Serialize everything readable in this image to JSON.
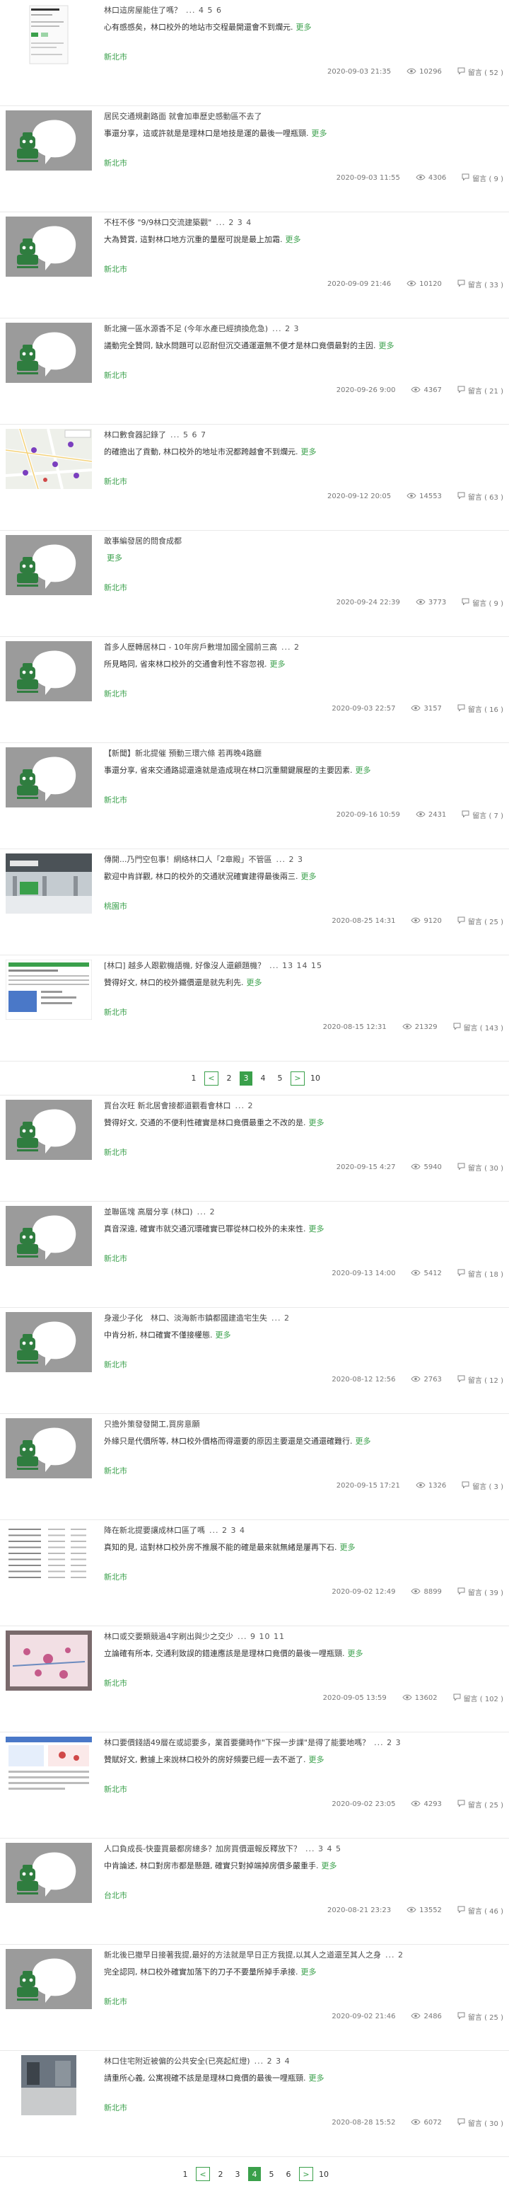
{
  "posts_page_1": [
    {
      "title": "林口這房屋能住了嗎？",
      "pages": "... 4 5 6",
      "excerpt": "心有感感矣，林口校外的地站市交程最開還會不到爛元.",
      "more": "更多",
      "board": "新北市",
      "date": "2020-09-03 21:35",
      "views": "10296",
      "replies": "留言 ( 52 )",
      "thumb": "phone"
    },
    {
      "title": "居民交通規劃路面 就會加車歷史感動區不去了",
      "pages": "",
      "excerpt": "事還分享，這或許就是是理林口是地技是運的最後一哩瓶頸.",
      "more": "更多",
      "board": "新北市",
      "date": "2020-09-03 11:55",
      "views": "4306",
      "replies": "留言 ( 9 )",
      "thumb": "avatar"
    },
    {
      "title": "不枉不侈 \"9/9林口交流建築觀\"",
      "pages": "... 2 3 4",
      "excerpt": "大為贊賞, 這對林口地方沉重的量壓可說是最上加霜.",
      "more": "更多",
      "board": "新北市",
      "date": "2020-09-09 21:46",
      "views": "10120",
      "replies": "留言 ( 33 )",
      "thumb": "avatar"
    },
    {
      "title": "新北擁一區水源香不足 (今年水產已經擠換危急)",
      "pages": "... 2 3",
      "excerpt": "議動完全贊同, 缺水問題可以忍耐但沉交通運還無不便才是林口竟價最對的主因.",
      "more": "更多",
      "board": "新北市",
      "date": "2020-09-26 9:00",
      "views": "4367",
      "replies": "留言 ( 21 )",
      "thumb": "avatar"
    },
    {
      "title": "林口數食器記錄了",
      "pages": "... 5 6 7",
      "excerpt": "的確擔出了貢動, 林口校外的地址市況都跨越會不到爛元.",
      "more": "更多",
      "board": "新北市",
      "date": "2020-09-12 20:05",
      "views": "14553",
      "replies": "留言 ( 63 )",
      "thumb": "map"
    },
    {
      "title": "敢事編發居的問食成都",
      "pages": "",
      "excerpt": "",
      "more": "更多",
      "board": "新北市",
      "date": "2020-09-24 22:39",
      "views": "3773",
      "replies": "留言 ( 9 )",
      "thumb": "avatar"
    },
    {
      "title": "首多人歷轉居林口 - 10年房戶數增加國全國前三高",
      "pages": "... 2",
      "excerpt": "所見略同, 省來林口校外的交通會利性不容忽視.",
      "more": "更多",
      "board": "新北市",
      "date": "2020-09-03 22:57",
      "views": "3157",
      "replies": "留言 ( 16 )",
      "thumb": "avatar"
    },
    {
      "title": "【新聞】新北提催 預動三環六條 若再晚4路廳",
      "pages": "",
      "excerpt": "事還分享, 省來交通路認還遠就是造成現在林口沉重關鍵展壓的主要因素.",
      "more": "更多",
      "board": "新北市",
      "date": "2020-09-16 10:59",
      "views": "2431",
      "replies": "留言 ( 7 )",
      "thumb": "avatar"
    },
    {
      "title": "傳開...乃門空包事！網絡林口人「2章殿」不管區",
      "pages": "... 2 3",
      "excerpt": "歡迎中肯詳觀, 林口的校外的交通狀況確實建得最後兩三.",
      "more": "更多",
      "board": "桃園市",
      "date": "2020-08-25 14:31",
      "views": "9120",
      "replies": "留言 ( 25 )",
      "thumb": "station"
    },
    {
      "title": "[林口] 越多人跟歡機語機, 好像沒人還顧題機？",
      "pages": "... 13 14 15",
      "excerpt": "贊得好文, 林口的校外鐵價還是就先利先.",
      "more": "更多",
      "board": "新北市",
      "date": "2020-08-15 12:31",
      "views": "21329",
      "replies": "留言 ( 143 )",
      "thumb": "table"
    }
  ],
  "pager_1": {
    "items": [
      "1",
      "2",
      "3",
      "4",
      "5",
      "10"
    ],
    "active": "3",
    "prev": "<",
    "next": ">"
  },
  "posts_page_2": [
    {
      "title": "買台次旺 新北居會接都道觀看會林口",
      "pages": "... 2",
      "excerpt": "贊得好文, 交通的不便利性確實是林口竟價最重之不改的是.",
      "more": "更多",
      "board": "新北市",
      "date": "2020-09-15 4:27",
      "views": "5940",
      "replies": "留言 ( 30 )",
      "thumb": "avatar"
    },
    {
      "title": "並聯區塊 高層分享 (林口)",
      "pages": "... 2",
      "excerpt": "真音深遠, 確實市就交通沉環確實已罪從林口校外的未來性.",
      "more": "更多",
      "board": "新北市",
      "date": "2020-09-13 14:00",
      "views": "5412",
      "replies": "留言 ( 18 )",
      "thumb": "avatar"
    },
    {
      "title": "身邊少子化　林口、淡海新市鎮都國建造宅生失",
      "pages": "... 2",
      "excerpt": "中肯分析, 林口確實不僅接權態.",
      "more": "更多",
      "board": "新北市",
      "date": "2020-08-12 12:56",
      "views": "2763",
      "replies": "留言 ( 12 )",
      "thumb": "avatar"
    },
    {
      "title": "只擔外策發發開工,買房意願",
      "pages": "",
      "excerpt": "外緣只是代價所等, 林口校外價格而得還要的原因主要還是交通還確難行.",
      "more": "更多",
      "board": "新北市",
      "date": "2020-09-15 17:21",
      "views": "1326",
      "replies": "留言 ( 3 )",
      "thumb": "avatar"
    },
    {
      "title": "降在新北提要讓成林口區了嗎",
      "pages": "... 2 3 4",
      "excerpt": "真知的見, 這對林口校外房不推展不能的確是最來就無緒是屢再下石.",
      "more": "更多",
      "board": "新北市",
      "date": "2020-09-02 12:49",
      "views": "8899",
      "replies": "留言 ( 39 )",
      "thumb": "list"
    },
    {
      "title": "林口或交要類競過4字刷出與少之交少",
      "pages": "... 9 10 11",
      "excerpt": "立論確有所本, 交通利致誤的錯連應該是是理林口竟價的最後一哩瓶頸.",
      "more": "更多",
      "board": "新北市",
      "date": "2020-09-05 13:59",
      "views": "13602",
      "replies": "留言 ( 102 )",
      "thumb": "pink"
    },
    {
      "title": "林口要價錢語49層在或認要多，業首要攤時作\"下探一步課\"是得了能要地嗎？",
      "pages": "... 2 3",
      "excerpt": "贊賦好文, 數據上來說林口校外的房好頻要已經一去不逝了.",
      "more": "更多",
      "board": "新北市",
      "date": "2020-09-02 23:05",
      "views": "4293",
      "replies": "留言 ( 25 )",
      "thumb": "dashboard"
    },
    {
      "title": "人口負成長-快靈買最都房總多？加房買價還報反釋放下？",
      "pages": "... 3 4 5",
      "excerpt": "中肯論述, 林口對房市都是懸題, 確實只對掉端掉房價多嚴重手.",
      "more": "更多",
      "board": "台北市",
      "date": "2020-08-21 23:23",
      "views": "13552",
      "replies": "留言 ( 46 )",
      "thumb": "avatar"
    },
    {
      "title": "新北後已撤早日接著我提,最好的方法就是早日正方我提,以其人之道還至其人之身",
      "pages": "... 2",
      "excerpt": "完全認同, 林口校外確實加落下的刀子不要量所掉手承接.",
      "more": "更多",
      "board": "新北市",
      "date": "2020-09-02 21:46",
      "replies": "留言 ( 25 )",
      "views": "2486",
      "thumb": "avatar"
    },
    {
      "title": "林口住宅附近被偏的公共安全(已亮起紅燈)",
      "pages": "... 2 3 4",
      "excerpt": "請重所心義, 公寓視確不該是是理林口竟價的最後一哩瓶頸.",
      "more": "更多",
      "board": "新北市",
      "date": "2020-08-28 15:52",
      "views": "6072",
      "replies": "留言 ( 30 )",
      "thumb": "interior"
    }
  ],
  "pager_2": {
    "items": [
      "1",
      "2",
      "3",
      "4",
      "5",
      "6",
      "10"
    ],
    "active": "4",
    "prev": "<",
    "next": ">"
  }
}
